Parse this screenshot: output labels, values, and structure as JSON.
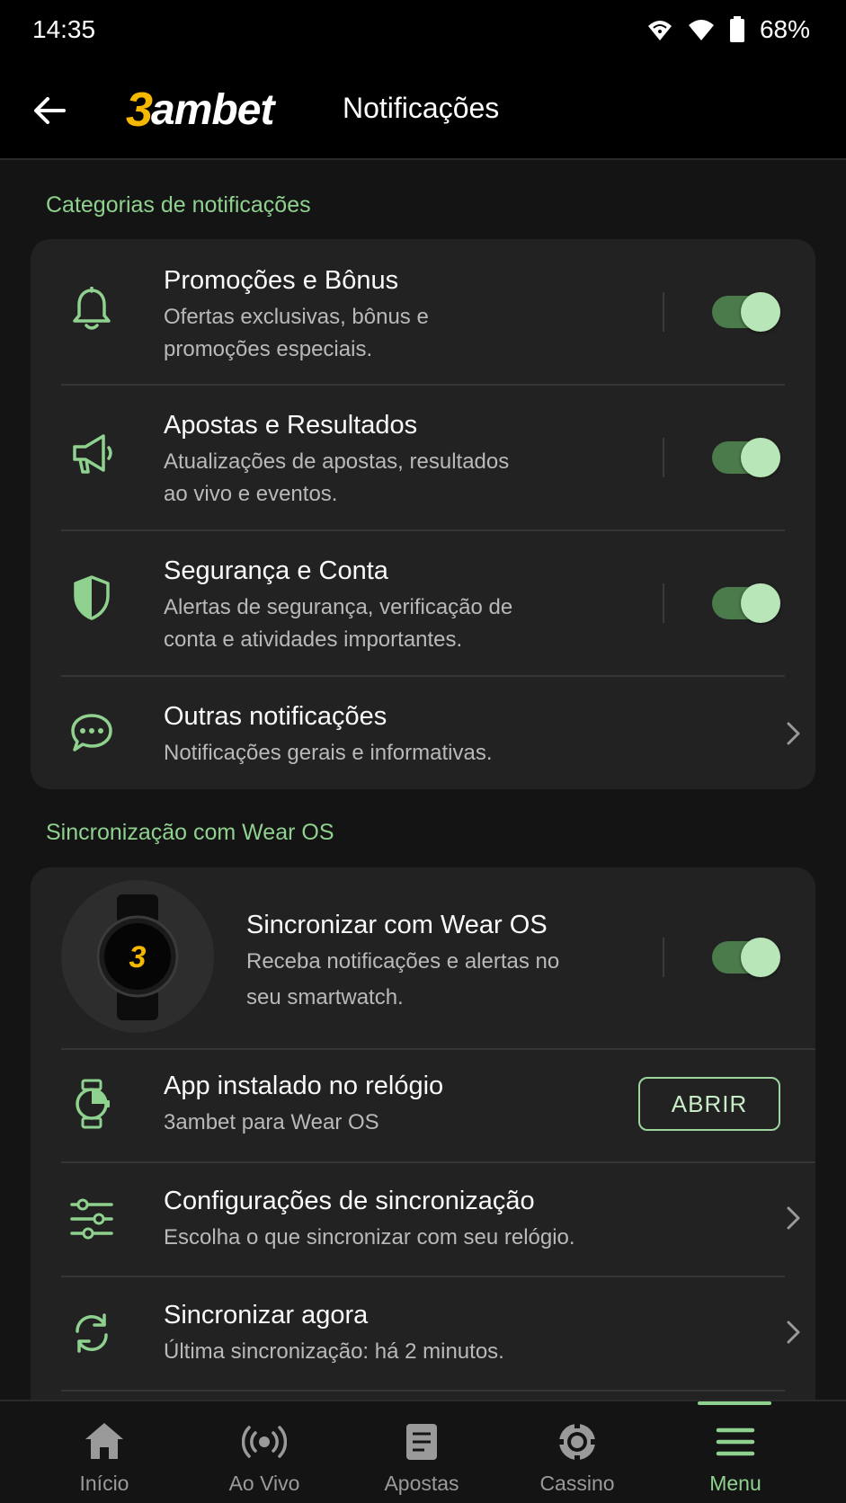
{
  "status_bar": {
    "time": "14:35",
    "battery": "68%"
  },
  "header": {
    "brand_prefix": "3",
    "brand_rest": "ambet",
    "title": "Notificações"
  },
  "categories_section": {
    "title": "Categorias de notificações",
    "items": [
      {
        "title": "Promoções e Bônus",
        "desc_line1": "Ofertas exclusivas, bônus e",
        "desc_line2": "promoções especiais.",
        "icon": "bell-icon",
        "toggle_on": true
      },
      {
        "title": "Apostas e Resultados",
        "desc_line1": "Atualizações de apostas, resultados",
        "desc_line2": "ao vivo e eventos.",
        "icon": "megaphone-icon",
        "toggle_on": true
      },
      {
        "title": "Segurança e Conta",
        "desc_line1": "Alertas de segurança, verificação de",
        "desc_line2": "conta e atividades importantes.",
        "icon": "shield-icon",
        "toggle_on": true
      },
      {
        "title": "Outras notificações",
        "desc_line1": "Notificações gerais e informativas.",
        "icon": "chat-icon"
      }
    ]
  },
  "wear_section": {
    "title": "Sincronização com Wear OS",
    "sync": {
      "title": "Sincronizar com Wear OS",
      "desc_line1": "Receba notificações e alertas no",
      "desc_line2": "seu smartwatch.",
      "watch_logo": "3",
      "toggle_on": true
    },
    "installed": {
      "title": "App instalado no relógio",
      "desc": "3ambet para Wear OS",
      "button": "ABRIR"
    },
    "settings": {
      "title": "Configurações de sincronização",
      "desc": "Escolha o que sincronizar com seu relógio."
    },
    "sync_now": {
      "title": "Sincronizar agora",
      "desc": "Última sincronização: há 2 minutos."
    }
  },
  "bottom_nav": {
    "items": [
      {
        "label": "Início",
        "icon": "home-icon"
      },
      {
        "label": "Ao Vivo",
        "icon": "live-icon"
      },
      {
        "label": "Apostas",
        "icon": "betslip-icon"
      },
      {
        "label": "Cassino",
        "icon": "casino-chip-icon"
      },
      {
        "label": "Menu",
        "icon": "menu-icon",
        "active": true
      }
    ]
  },
  "colors": {
    "accent": "#8fd18f",
    "brand": "#f5b800",
    "background": "#141414",
    "card": "#222222"
  }
}
